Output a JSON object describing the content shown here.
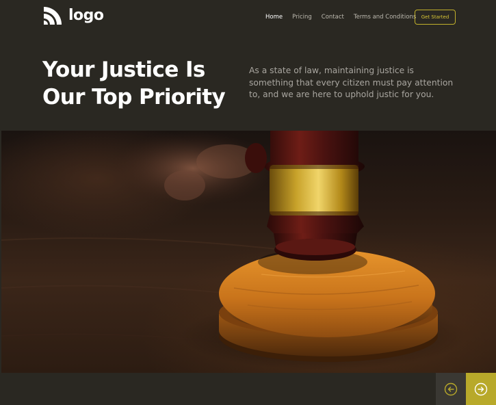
{
  "brand": {
    "logo_text": "logo"
  },
  "nav": {
    "items": [
      {
        "label": "Home",
        "active": true
      },
      {
        "label": "Pricing",
        "active": false
      },
      {
        "label": "Contact",
        "active": false
      },
      {
        "label": "Terms and Conditions",
        "active": false
      }
    ],
    "cta_label": "Get Started"
  },
  "hero": {
    "headline_line1": "Your Justice Is",
    "headline_line2": "Our Top Priority",
    "subtext": "As a state of law, maintaining justice is something that every citizen must pay attention to, and we are here to uphold justic for you."
  },
  "slider": {
    "prev_icon": "arrow-left-circle-icon",
    "next_icon": "arrow-right-circle-icon"
  },
  "colors": {
    "background": "#2a2822",
    "accent": "#b8a92a",
    "cta_border": "#c2b12b",
    "text_muted": "#a9a6a0",
    "text_white": "#ffffff"
  }
}
